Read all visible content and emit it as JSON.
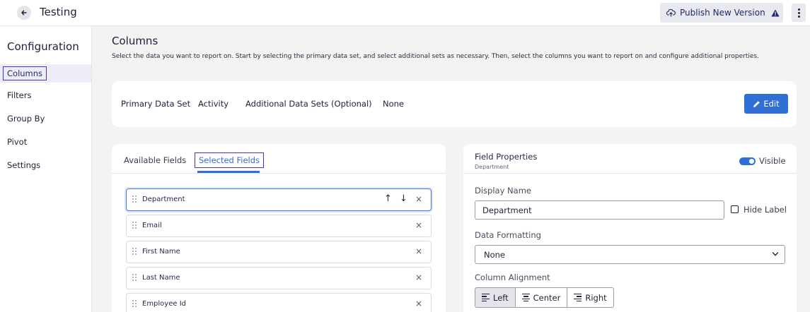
{
  "header": {
    "title": "Testing",
    "publish_label": "Publish New Version"
  },
  "sidebar": {
    "heading": "Configuration",
    "items": [
      {
        "label": "Columns"
      },
      {
        "label": "Filters"
      },
      {
        "label": "Group By"
      },
      {
        "label": "Pivot"
      },
      {
        "label": "Settings"
      }
    ]
  },
  "main": {
    "title": "Columns",
    "description": "Select the data you want to report on. Start by selecting the primary data set, and select additional sets as necessary. Then, select the columns you want to report on and configure additional properties.",
    "data_sets": {
      "primary_label": "Primary Data Set",
      "primary_value": "Activity",
      "additional_label": "Additional Data Sets (Optional)",
      "additional_value": "None",
      "edit_label": "Edit"
    },
    "fields_panel": {
      "tabs": [
        {
          "label": "Available Fields"
        },
        {
          "label": "Selected Fields"
        }
      ],
      "selected_fields": [
        {
          "name": "Department"
        },
        {
          "name": "Email"
        },
        {
          "name": "First Name"
        },
        {
          "name": "Last Name"
        },
        {
          "name": "Employee Id"
        }
      ]
    },
    "field_properties": {
      "title": "Field Properties",
      "subtitle": "Department",
      "visible_label": "Visible",
      "display_name_label": "Display Name",
      "display_name_value": "Department",
      "hide_label": "Hide Label",
      "data_formatting_label": "Data Formatting",
      "data_formatting_value": "None",
      "column_alignment_label": "Column Alignment",
      "alignment_options": [
        {
          "label": "Left"
        },
        {
          "label": "Center"
        },
        {
          "label": "Right"
        }
      ]
    }
  },
  "colors": {
    "accent": "#2f6fd6",
    "focus_outline": "#4b2fc7",
    "warning": "#1f2a6b"
  },
  "icons": {
    "back": "arrow-left-icon",
    "publish": "cloud-upload-icon",
    "warning": "warning-triangle-icon",
    "more": "kebab-icon",
    "edit": "pencil-icon",
    "drag": "drag-handle-icon",
    "up": "arrow-up-icon",
    "down": "arrow-down-icon",
    "remove": "close-icon",
    "dropdown": "chevron-down-icon"
  }
}
